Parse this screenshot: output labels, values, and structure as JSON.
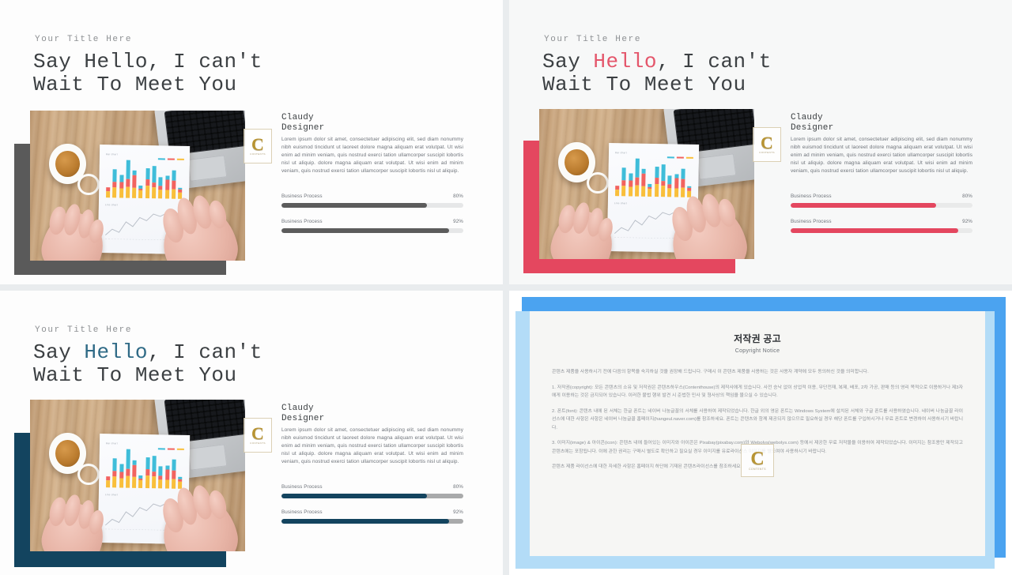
{
  "deck": {
    "slides": [
      {
        "id": "slide-gray",
        "eyebrow": "Your Title Here",
        "headline_before": "Say ",
        "headline_accent": "Hello",
        "headline_after": ", I can't\nWait To Meet You",
        "accent_color": "#5c5c5c",
        "accent_text_color": "#3c4043",
        "person_name": "Claudy\nDesigner",
        "body": "Lorem ipsum dolor sit amet, consectetuer adipiscing elit, sed diam nonummy nibh euismod tincidunt ut laoreet dolore magna aliquam erat volutpat. Ut wisi enim ad minim veniam, quis nostrud exerci tation ullamcorper suscipit lobortis nisl ut aliquip. dolore magna aliquam erat volutpat. Ut wisi enim ad minim veniam, quis nostrud exerci tation ullamcorper suscipit lobortis nisl ut aliquip.",
        "progress": [
          {
            "label": "Business Process",
            "value": "80%",
            "pct": 80
          },
          {
            "label": "Business Process",
            "value": "92%",
            "pct": 92
          }
        ]
      },
      {
        "id": "slide-red",
        "eyebrow": "Your Title Here",
        "headline_before": "Say ",
        "headline_accent": "Hello",
        "headline_after": ", I can't\nWait To Meet You",
        "accent_color": "#e4475f",
        "accent_text_color": "#e4566b",
        "person_name": "Claudy\nDesigner",
        "body": "Lorem ipsum dolor sit amet, consectetuer adipiscing elit, sed diam nonummy nibh euismod tincidunt ut laoreet dolore magna aliquam erat volutpat. Ut wisi enim ad minim veniam, quis nostrud exerci tation ullamcorper suscipit lobortis nisl ut aliquip. dolore magna aliquam erat volutpat. Ut wisi enim ad minim veniam, quis nostrud exerci tation ullamcorper suscipit lobortis nisl ut aliquip.",
        "progress": [
          {
            "label": "Business Process",
            "value": "80%",
            "pct": 80
          },
          {
            "label": "Business Process",
            "value": "92%",
            "pct": 92
          }
        ]
      },
      {
        "id": "slide-teal",
        "eyebrow": "Your Title Here",
        "headline_before": "Say ",
        "headline_accent": "Hello",
        "headline_after": ", I can't\nWait To Meet You",
        "accent_color": "#13445f",
        "accent_text_color": "#2f6a86",
        "person_name": "Claudy\nDesigner",
        "body": "Lorem ipsum dolor sit amet, consectetuer adipiscing elit, sed diam nonummy nibh euismod tincidunt ut laoreet dolore magna aliquam erat volutpat. Ut wisi enim ad minim veniam, quis nostrud exerci tation ullamcorper suscipit lobortis nisl ut aliquip. dolore magna aliquam erat volutpat. Ut wisi enim ad minim veniam, quis nostrud exerci tation ullamcorper suscipit lobortis nisl ut aliquip.",
        "progress": [
          {
            "label": "Business Process",
            "value": "80%",
            "pct": 80
          },
          {
            "label": "Business Process",
            "value": "92%",
            "pct": 92
          }
        ]
      }
    ]
  },
  "copyright_slide": {
    "id": "slide-copyright",
    "frame_color": "#4ba3f0",
    "frame_light_color": "#b3dcf7",
    "title": "저작권 공고",
    "subtitle": "Copyright Notice",
    "paragraphs": [
      "콘텐츠 제품을 사용하시기 전에 다음의 항목을 숙지하실 것을 권장해 드립니다. 구매시 이 콘텐츠 제품을 사용하는 것은 사용자 계약에 모두 동의하신 것을 의미합니다.",
      "1. 저작권(copyright): 모든 콘텐츠의 소유 및 저작권은 콘텐츠하우스(Contenthouse)의 제작사에게 있습니다. 사전 승낙 없이 상업적 이용, 무단전재, 복제, 배포, 2차 가공, 판매 등의 영리 목적으로 이용하거나 제3자에게 이용하는 것은 금지되어 있습니다. 이러한 불법 행위 발견 시 준법한 민사 및 형사상의 책임을 물으실 수 있습니다.",
      "2. 폰트(font): 콘텐츠 내에 된 서체는 한글 폰트는 네이버 나눔글꼴의 서체를 사용하여 제작되었습니다. 한글 외의 영문 폰트는 Windows System에 설치된 서체와 구글 폰트를 사용하였습니다. 네이버 나눔글꼴 라이선스에 대한 사항은 사항은 네이버 나눔글꼴 홈페이지(hangeul.naver.com)를 참조하세요. 폰트는 콘텐츠와 함께 제공되지 않으므로 필요하실 경우 해당 폰트를 구입하시거나 무료 폰트로 변경하여 사용하시기 바랍니다.",
      "3. 이미지(image) & 아이콘(icon): 콘텐츠 내에 들어있는 이미지와 아이콘은 Pixabay(pixabay.com)와 Webolys(webolys.com) 등에서 제공한 무료 저작물을 이용하여 제작되었습니다. 이미지는 참조용만 제작되고 콘텐츠에는 포함됩니다. 이에 관한 권리는 구매시 별도로 확인하고 필요실 경우 이미지를 유료라이선스 이미지를 별도여야 사용하시기 바랍니다.",
      "콘텐츠 제품 라이선스에 대한 자세한 사항은 홈페이지 하단에 기재된 콘텐츠라이선스를 참조하세요."
    ],
    "watermark": {
      "letter": "C",
      "caption": "CONTENTS"
    }
  },
  "photo": {
    "alt_name": "desk-photo",
    "bar_chart": {
      "type": "bar",
      "stacked": true,
      "series": [
        {
          "name": "cyan",
          "color": "#3fbdd9"
        },
        {
          "name": "red",
          "color": "#f2635f"
        },
        {
          "name": "yellow",
          "color": "#f9bf3b"
        }
      ],
      "bars": [
        {
          "c": 0,
          "r": 8,
          "y": 14
        },
        {
          "c": 26,
          "r": 12,
          "y": 22
        },
        {
          "c": 16,
          "r": 13,
          "y": 20
        },
        {
          "c": 40,
          "r": 16,
          "y": 24
        },
        {
          "c": 10,
          "r": 26,
          "y": 22
        },
        {
          "c": 6,
          "r": 4,
          "y": 16
        },
        {
          "c": 24,
          "r": 14,
          "y": 26
        },
        {
          "c": 34,
          "r": 10,
          "y": 24
        },
        {
          "c": 20,
          "r": 8,
          "y": 18
        },
        {
          "c": 8,
          "r": 22,
          "y": 18
        },
        {
          "c": 22,
          "r": 18,
          "y": 20
        },
        {
          "c": 4,
          "r": 6,
          "y": 14
        }
      ],
      "legend": [
        "#3fbdd9",
        "#f2635f",
        "#f9bf3b"
      ],
      "top_label": "Bar chart",
      "bottom_label": "Line chart"
    },
    "line_chart": {
      "type": "line",
      "values": [
        12,
        20,
        16,
        30,
        24,
        38,
        34,
        48,
        44,
        58,
        52,
        62
      ],
      "color": "#b9bfc8"
    },
    "watermark": {
      "letter": "C",
      "caption": "CONTENTS"
    }
  }
}
